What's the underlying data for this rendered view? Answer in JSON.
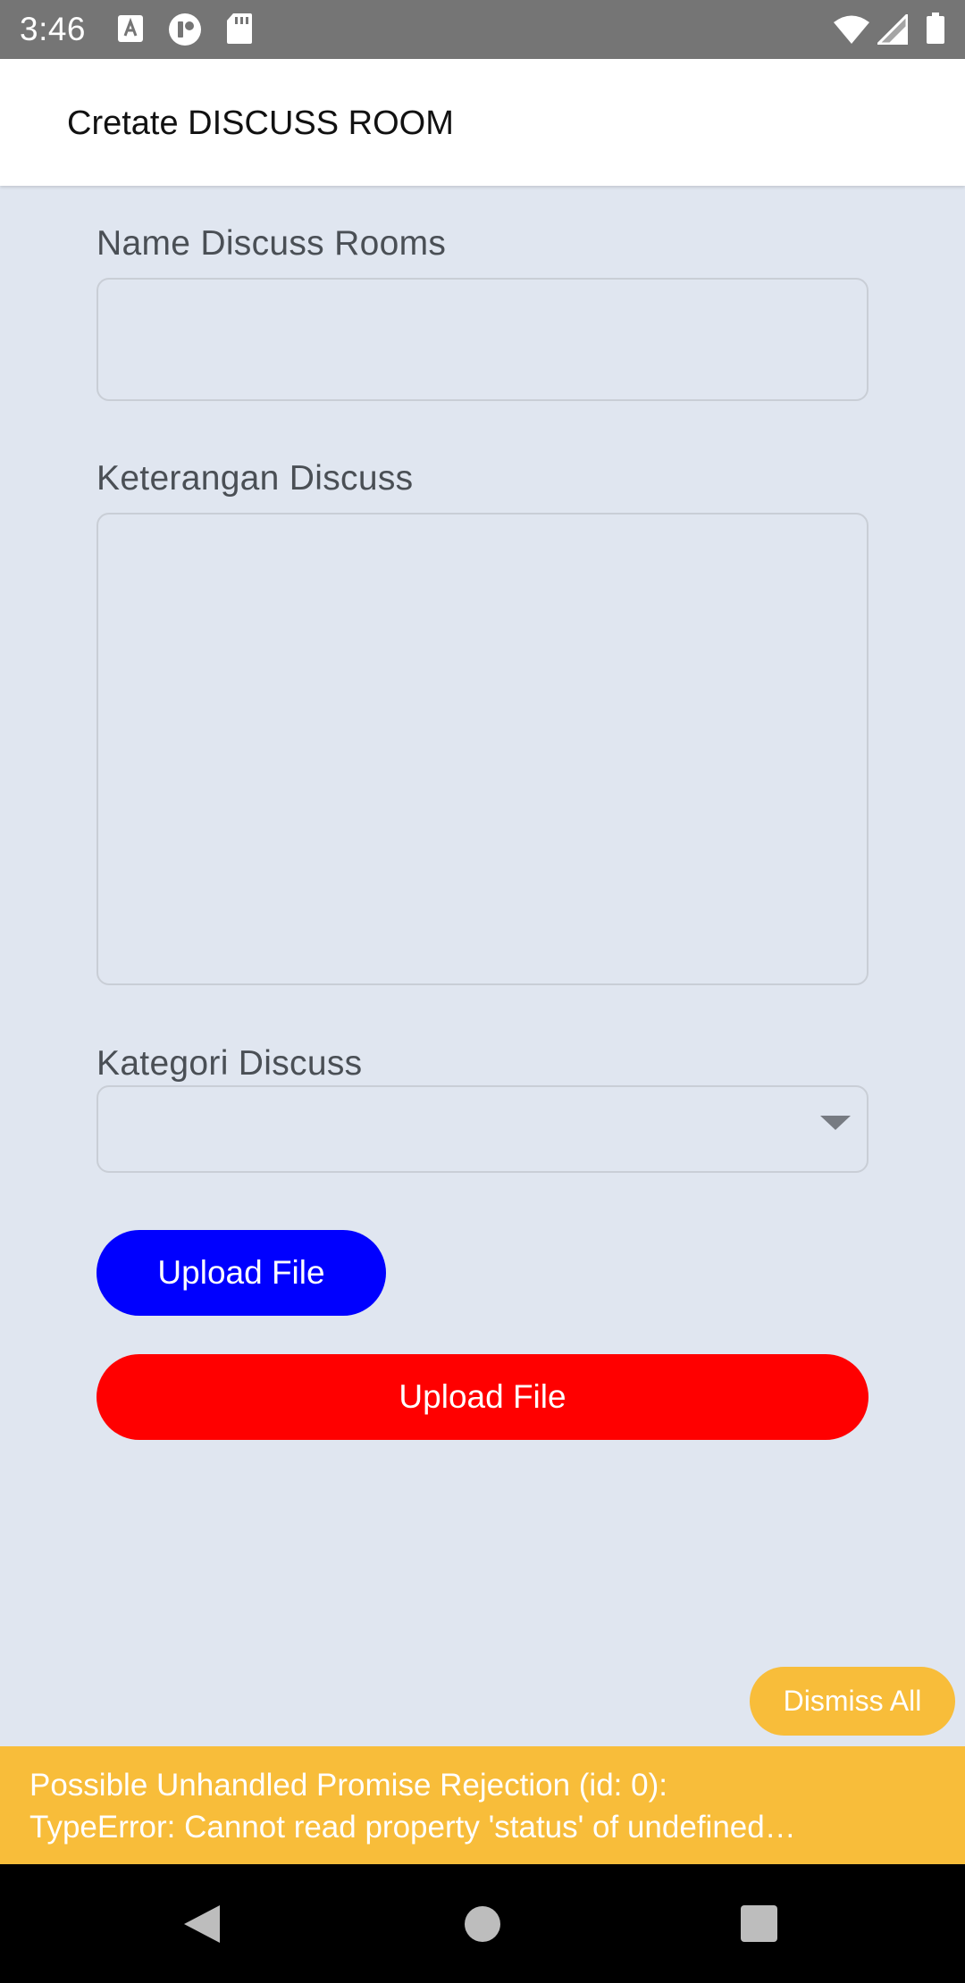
{
  "status_bar": {
    "time": "3:46",
    "icons": [
      "a-notification-icon",
      "circle-app-icon",
      "sd-card-icon",
      "wifi-icon",
      "signal-icon",
      "battery-icon"
    ]
  },
  "app_bar": {
    "title": "Cretate DISCUSS ROOM"
  },
  "form": {
    "name_label": "Name Discuss Rooms",
    "name_value": "",
    "description_label": "Keterangan Discuss",
    "description_value": "",
    "category_label": "Kategori Discuss",
    "category_selected": "",
    "upload_button_label": "Upload File",
    "submit_button_label": "Upload File"
  },
  "warning": {
    "dismiss_label": "Dismiss All",
    "line1": "Possible Unhandled Promise Rejection (id: 0):",
    "line2": "TypeError: Cannot read property 'status' of undefined…"
  },
  "colors": {
    "background": "#e0e6f0",
    "upload_button": "#0000ff",
    "submit_button": "#ff0000",
    "warning": "#f8bd3a",
    "status_bar": "#757575"
  }
}
